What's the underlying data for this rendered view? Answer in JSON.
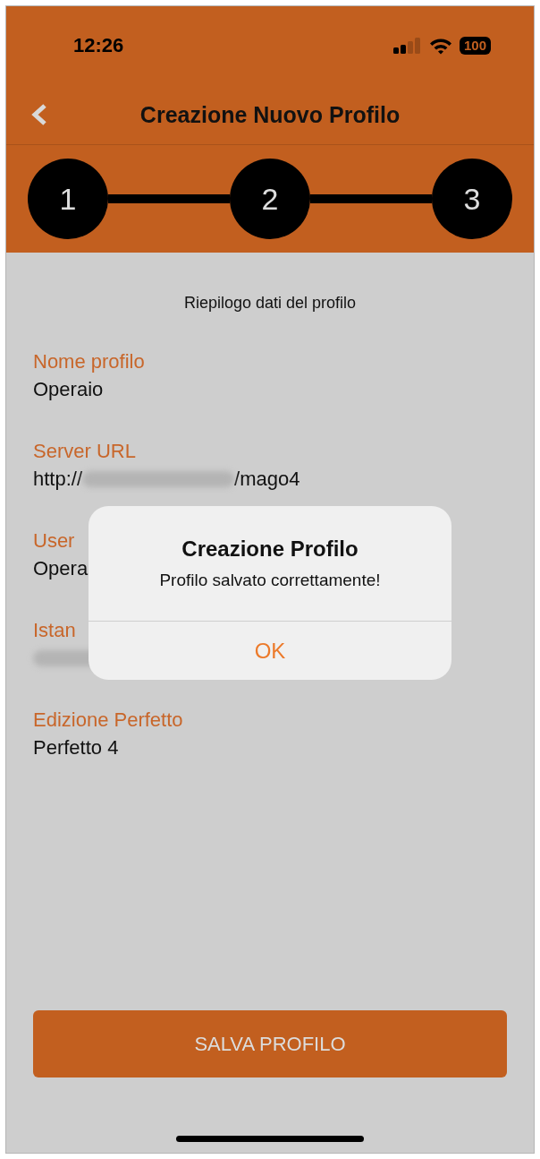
{
  "status_bar": {
    "time": "12:26",
    "battery": "100"
  },
  "nav": {
    "title": "Creazione Nuovo Profilo"
  },
  "stepper": [
    "1",
    "2",
    "3"
  ],
  "summary": {
    "heading": "Riepilogo dati del profilo",
    "fields": [
      {
        "label": "Nome profilo",
        "value": "Operaio",
        "redacted": false
      },
      {
        "label": "Server URL",
        "value": "http://",
        "redacted": true,
        "value_after": "/mago4"
      },
      {
        "label": "User",
        "value": "Opera",
        "redacted": false
      },
      {
        "label": "Istan",
        "redacted": true
      },
      {
        "label": "Edizione Perfetto",
        "value": "Perfetto 4",
        "redacted": false
      }
    ]
  },
  "save_button": "SALVA PROFILO",
  "alert": {
    "title": "Creazione Profilo",
    "message": "Profilo salvato correttamente!",
    "button": "OK"
  }
}
